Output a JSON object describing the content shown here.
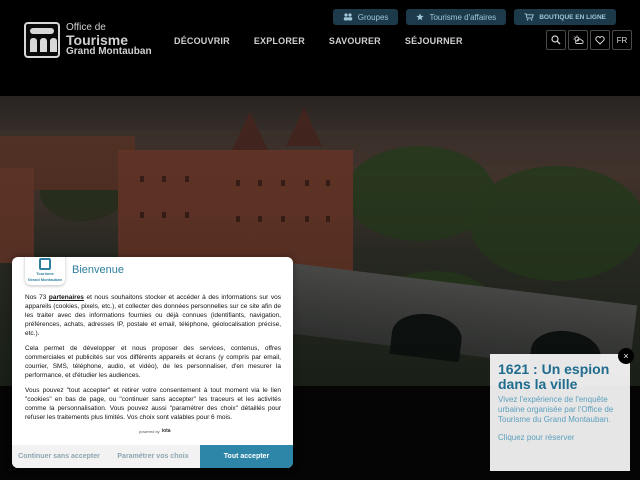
{
  "header": {
    "logo": {
      "line1": "Office de",
      "line2": "Tourisme",
      "line3": "Grand Montauban"
    },
    "top_links": [
      {
        "label": "Groupes",
        "icon": "group-icon"
      },
      {
        "label": "Tourisme d'affaires",
        "icon": "star-icon"
      },
      {
        "label": "BOUTIQUE EN LIGNE",
        "icon": "cart-icon"
      }
    ],
    "nav": [
      "DÉCOUVRIR",
      "EXPLORER",
      "SAVOURER",
      "SÉJOURNER"
    ],
    "tools": {
      "search_icon": "search-icon",
      "weather_icon": "weather-icon",
      "favorites_icon": "heart-icon",
      "language": "FR"
    }
  },
  "promo": {
    "title": "1621 : Un espion dans la ville",
    "body": "Vivez l'expérience de l'enquête urbaine organisée par l'Office de Tourisme du Grand Montauban.",
    "link": "Cliquez pour réserver",
    "close_label": "×"
  },
  "consent": {
    "title": "Bienvenue",
    "logo": {
      "line1": "Tourisme",
      "line2": "Grand Montauban"
    },
    "body": {
      "p1_a": "Nos 73 ",
      "p1_link": "partenaires",
      "p1_b": " et nous souhaitons stocker et accéder à des informations sur vos appareils (cookies, pixels, etc.), et collecter des données personnelles sur ce site afin de les traiter avec des informations fournies ou déjà connues (identifiants, navigation, préférences, achats, adresses IP, postale et email, téléphone, géolocalisation précise, etc.).",
      "p2": "Cela permet de développer et nous proposer des services, contenus, offres commerciales et publicités sur vos différents appareils et écrans (y compris par email, courrier, SMS, téléphone, audio, et vidéo), de les personnaliser, d'en mesurer la performance, et d'étudier les audiences.",
      "p3": "Vous pouvez \"tout accepter\" et retirer votre consentement à tout moment via le lien \"cookies\" en bas de page, ou \"continuer sans accepter\" les traceurs et les activités comme la personnalisation. Vous pouvez aussi \"paramétrer des choix\" détaillés pour refuser les traitements plus limités. Vos choix sont valables pour 6 mois."
    },
    "powered_by": "powered by",
    "powered_brand": "iota",
    "buttons": {
      "continue": "Continuer sans accepter",
      "settings": "Paramétrer vos choix",
      "accept": "Tout accepter"
    }
  },
  "colors": {
    "header_bg": "#000000",
    "pill_bg": "#1c3a4a",
    "pill_text": "#9fc7d8",
    "accent": "#2d86a8",
    "promo_title": "#1f6c8f"
  }
}
